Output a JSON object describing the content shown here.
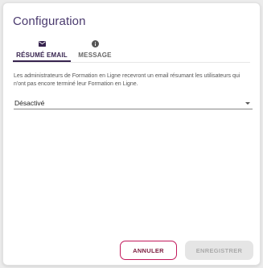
{
  "dialog": {
    "title": "Configuration",
    "tabs": [
      {
        "label": "RÉSUMÉ EMAIL",
        "icon": "mail-icon",
        "active": true
      },
      {
        "label": "MESSAGE",
        "icon": "info-icon",
        "active": false
      }
    ],
    "description": "Les administrateurs de Formation en Ligne recevront un email résumant les utilisateurs qui n'ont pas encore terminé leur Formation en Ligne.",
    "select": {
      "value": "Désactivé"
    },
    "buttons": {
      "cancel": "ANNULER",
      "save": "ENREGISTRER"
    },
    "colors": {
      "title": "#4a3a6e",
      "active_tab": "#37244f",
      "cancel_border": "#c2185b",
      "disabled_bg": "#e5e5e5"
    }
  }
}
